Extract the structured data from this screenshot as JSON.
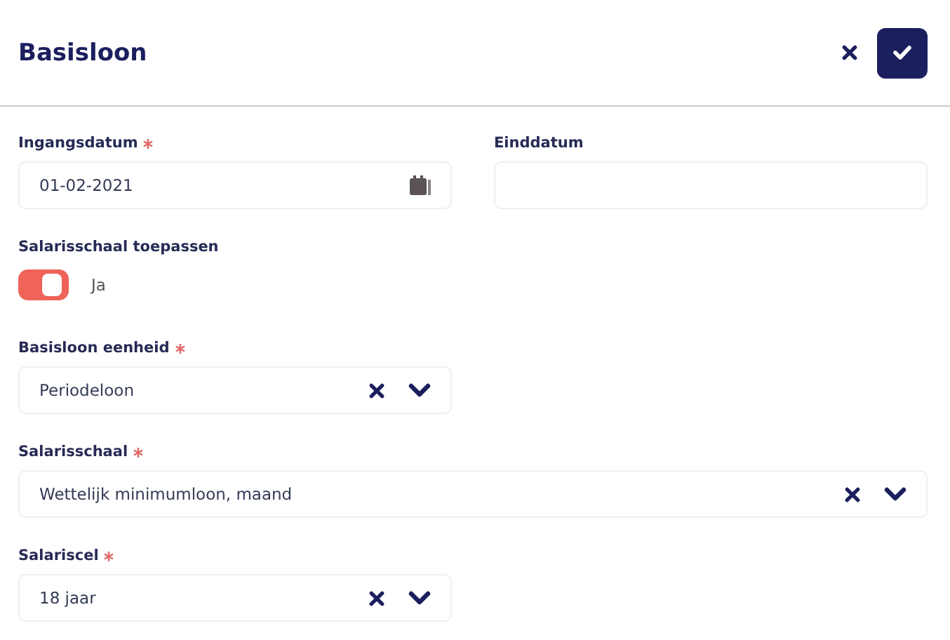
{
  "header": {
    "title": "Basisloon"
  },
  "date_fields": [
    {
      "label": "Ingangsdatum",
      "required": true,
      "value": "01-02-2021",
      "calendar": true
    },
    {
      "label": "Einddatum",
      "required": false,
      "calendar": false
    }
  ],
  "toggle": {
    "label": "Salarisschaal toepassen",
    "on": true,
    "text": "Ja"
  },
  "selects": [
    {
      "label": "Basisloon eenheid",
      "required": true,
      "value": "Periodeloon",
      "wide": false
    },
    {
      "label": "Salarisschaal",
      "required": true,
      "value": "Wettelijk minimumloon, maand",
      "wide": true
    },
    {
      "label": "Salariscel",
      "required": true,
      "value": "18 jaar",
      "wide": false
    }
  ]
}
